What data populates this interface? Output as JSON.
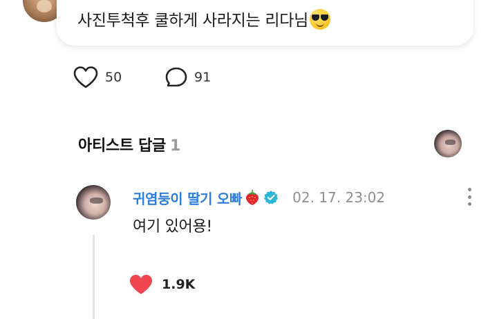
{
  "post": {
    "text": "사진투척후 쿨하게 사라지는 리다님",
    "emoji": "smiling-face-with-sunglasses"
  },
  "reactions": {
    "likes": "50",
    "comments": "91"
  },
  "artist_replies": {
    "title": "아티스트 답글",
    "count": "1"
  },
  "comment": {
    "author": "귀염둥이 딸기 오빠",
    "author_emoji": "strawberry",
    "verified_badge": "verified-check",
    "timestamp": "02. 17. 23:02",
    "text": "여기 있어용!",
    "likes": "1.9K"
  },
  "colors": {
    "author_name": "#2b7de0",
    "like_heart": "#f0454f",
    "verified_badge": "#29b6d6",
    "muted_text": "#8e8e8e"
  }
}
